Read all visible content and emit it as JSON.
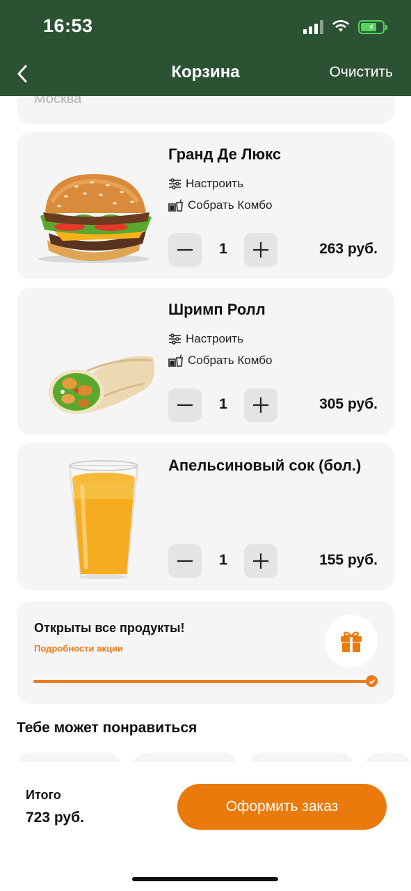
{
  "status_bar": {
    "time": "16:53"
  },
  "header": {
    "title": "Корзина",
    "clear_label": "Очистить"
  },
  "address": {
    "city": "Москва"
  },
  "cart": {
    "items": [
      {
        "title": "Гранд Де Люкс",
        "customize_label": "Настроить",
        "combo_label": "Собрать Комбо",
        "quantity": "1",
        "price": "263 руб."
      },
      {
        "title": "Шримп Ролл",
        "customize_label": "Настроить",
        "combo_label": "Собрать Комбо",
        "quantity": "1",
        "price": "305 руб."
      },
      {
        "title": "Апельсиновый сок (бол.)",
        "quantity": "1",
        "price": "155 руб."
      }
    ]
  },
  "promo": {
    "title": "Открыты все продукты!",
    "link_label": "Подробности акции",
    "progress": 1.0
  },
  "recommendations": {
    "title": "Тебе может понравиться"
  },
  "footer": {
    "total_label": "Итого",
    "total_value": "723 руб.",
    "checkout_label": "Оформить заказ"
  },
  "colors": {
    "header_bg": "#2c5234",
    "accent": "#ea7a0b",
    "card_bg": "#f5f5f5"
  }
}
